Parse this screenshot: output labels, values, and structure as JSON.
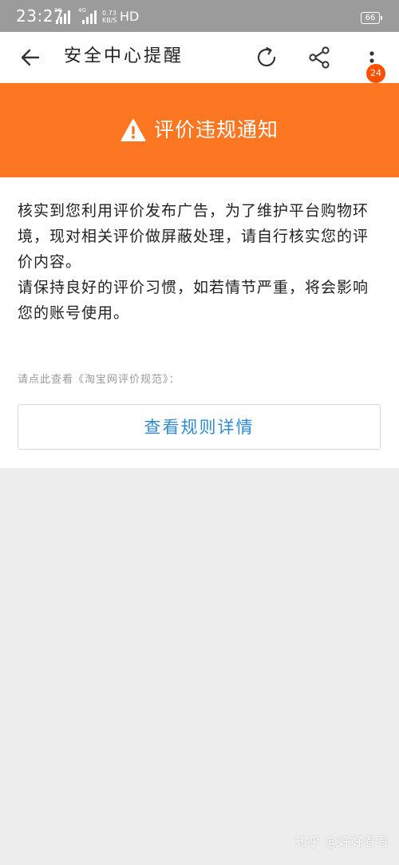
{
  "status_bar": {
    "time": "23:27",
    "signal_1_tag": "2G",
    "signal_2_tag": "4G",
    "net_speed_value": "0.73",
    "net_speed_unit": "KB/S",
    "hd_label": "HD",
    "battery": "66"
  },
  "nav": {
    "title": "安全中心提醒",
    "back_icon": "arrow-left",
    "refresh_icon": "refresh",
    "share_icon": "share",
    "more_icon": "more-vertical",
    "badge_count": "24"
  },
  "banner": {
    "icon": "warning-triangle",
    "title": "评价违规通知",
    "color": "#fd7622"
  },
  "content": {
    "paragraph_1": "核实到您利用评价发布广告，为了维护平台购物环境，现对相关评价做屏蔽处理，请自行核实您的评价内容。",
    "paragraph_2": "请保持良好的评价习惯，如若情节严重，将会影响您的账号使用。",
    "rules_hint": "请点此查看《淘宝网评价规范》：",
    "rules_button_label": "查看规则详情"
  },
  "watermark": "知乎 @好好看看",
  "colors": {
    "accent_orange": "#fd7622",
    "badge_orange": "#ff5000",
    "link_blue": "#2f8ad4",
    "background": "#ededed",
    "status_bar": "#9b9b9b"
  }
}
